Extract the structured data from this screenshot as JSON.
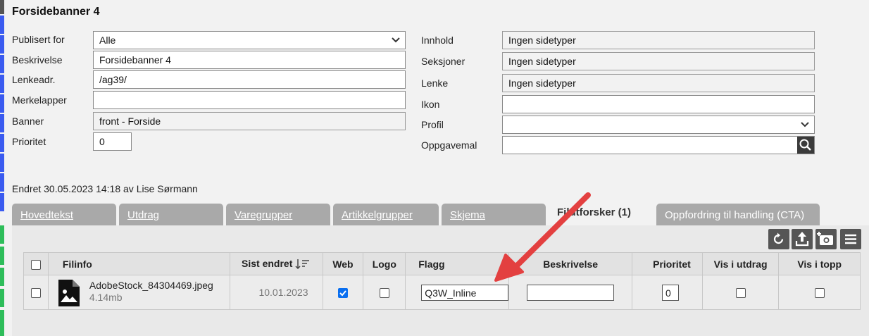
{
  "title": "Forsidebanner 4",
  "left_fields": {
    "publisert_label": "Publisert for",
    "publisert_value": "Alle",
    "beskrivelse_label": "Beskrivelse",
    "beskrivelse_value": "Forsidebanner 4",
    "lenke_label": "Lenkeadr.",
    "lenke_value": "/ag39/",
    "merke_label": "Merkelapper",
    "merke_value": "",
    "banner_label": "Banner",
    "banner_value": "front - Forside",
    "prioritet_label": "Prioritet",
    "prioritet_value": "0"
  },
  "right_fields": {
    "innhold_label": "Innhold",
    "innhold_value": "Ingen sidetyper",
    "seksjoner_label": "Seksjoner",
    "seksjoner_value": "Ingen sidetyper",
    "lenke_label": "Lenke",
    "lenke_value": "Ingen sidetyper",
    "ikon_label": "Ikon",
    "ikon_value": "",
    "profil_label": "Profil",
    "profil_value": "",
    "oppgave_label": "Oppgavemal",
    "oppgave_value": ""
  },
  "changed_text": "Endret 30.05.2023 14:18 av Lise Sørmann",
  "tabs": {
    "hovedtekst": "Hovedtekst",
    "utdrag": "Utdrag",
    "varegrupper": "Varegrupper",
    "artikkelgrupper": "Artikkelgrupper",
    "skjema": "Skjema",
    "filutforsker": "Filutforsker (1)",
    "cta": "Oppfordring til handling (CTA)"
  },
  "table": {
    "headers": {
      "filinfo": "Filinfo",
      "sist_endret": "Sist endret",
      "web": "Web",
      "logo": "Logo",
      "flagg": "Flagg",
      "beskrivelse": "Beskrivelse",
      "prioritet": "Prioritet",
      "vis_utdrag": "Vis i utdrag",
      "vis_topp": "Vis i topp"
    },
    "row": {
      "filename": "AdobeStock_84304469.jpeg",
      "size": "4.14mb",
      "date": "10.01.2023",
      "web_checked": true,
      "logo_checked": false,
      "flagg": "Q3W_Inline",
      "beskrivelse": "",
      "prioritet": "0"
    }
  },
  "colors": {
    "tab_inactive": "#a9a9a9",
    "arrow": "#e34040",
    "checkbox_on": "#0a6ff0"
  }
}
